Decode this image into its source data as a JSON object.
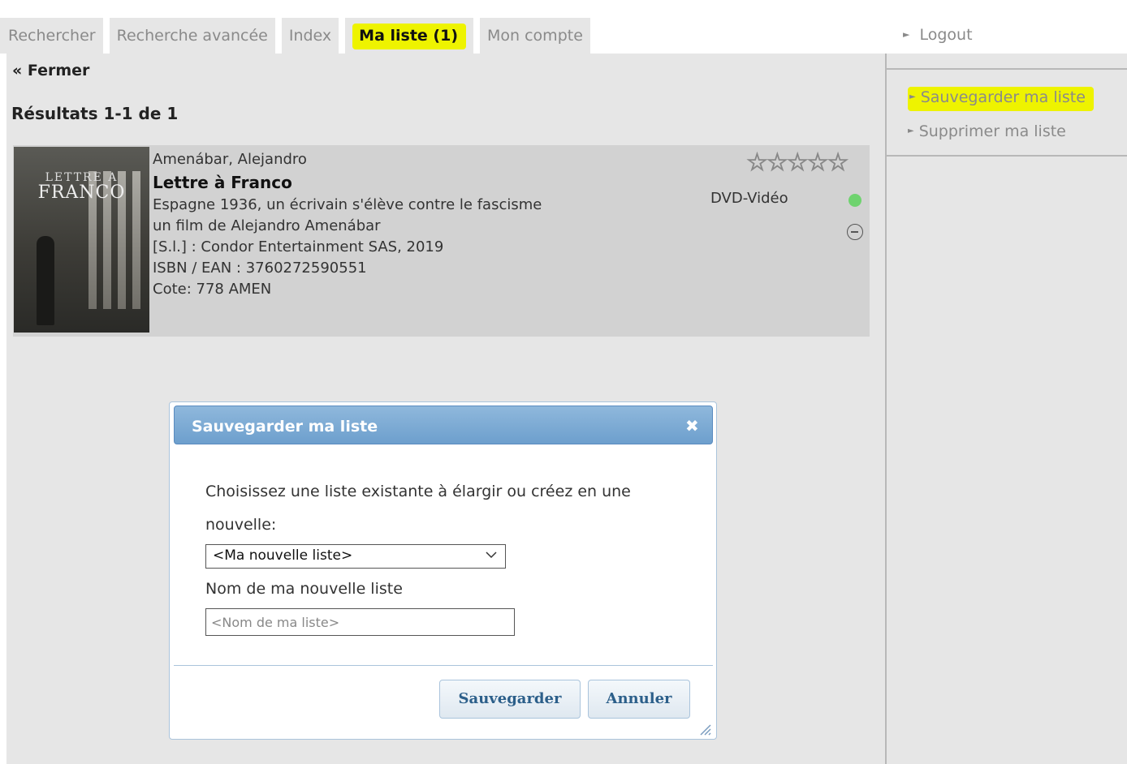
{
  "tabs": [
    {
      "label": "Rechercher"
    },
    {
      "label": "Recherche avancée"
    },
    {
      "label": "Index"
    },
    {
      "label": "Ma liste (1)"
    },
    {
      "label": "Mon compte"
    }
  ],
  "active_tab": "Ma liste (1)",
  "sidebar": {
    "logout_label": "Logout",
    "links": [
      {
        "label": "Sauvegarder ma liste",
        "highlighted": true
      },
      {
        "label": "Supprimer ma liste",
        "highlighted": false
      }
    ]
  },
  "main": {
    "close_label": "« Fermer",
    "results_title": "Résultats 1-1 de 1"
  },
  "result": {
    "author": "Amenábar, Alejandro",
    "title": "Lettre à Franco",
    "subtitle": "Espagne 1936, un écrivain s'élève contre le fascisme",
    "credit": "un film de Alejandro Amenábar",
    "publisher": "[S.l.] : Condor Entertainment SAS, 2019",
    "isbn": "ISBN / EAN : 3760272590551",
    "shelf": "Cote: 778 AMEN",
    "format": "DVD-Vidéo",
    "rating_stars": "☆☆☆☆☆",
    "rating_value": 0,
    "rating_max": 5,
    "availability_color": "#6fd36f",
    "cover_text_line1": "LETTRE A",
    "cover_text_line2": "FRANCO"
  },
  "dialog": {
    "title": "Sauvegarder ma liste",
    "close_glyph": "✖",
    "prompt": "Choisissez une liste existante à élargir ou créez en une nouvelle:",
    "select_value": "<Ma nouvelle liste>",
    "name_label": "Nom de ma nouvelle liste",
    "name_placeholder": "<Nom de ma liste>",
    "save_label": "Sauvegarder",
    "cancel_label": "Annuler"
  },
  "colors": {
    "highlight": "#eef300",
    "dialog_header": "#7aaad4",
    "button_text": "#2c5f8a"
  }
}
